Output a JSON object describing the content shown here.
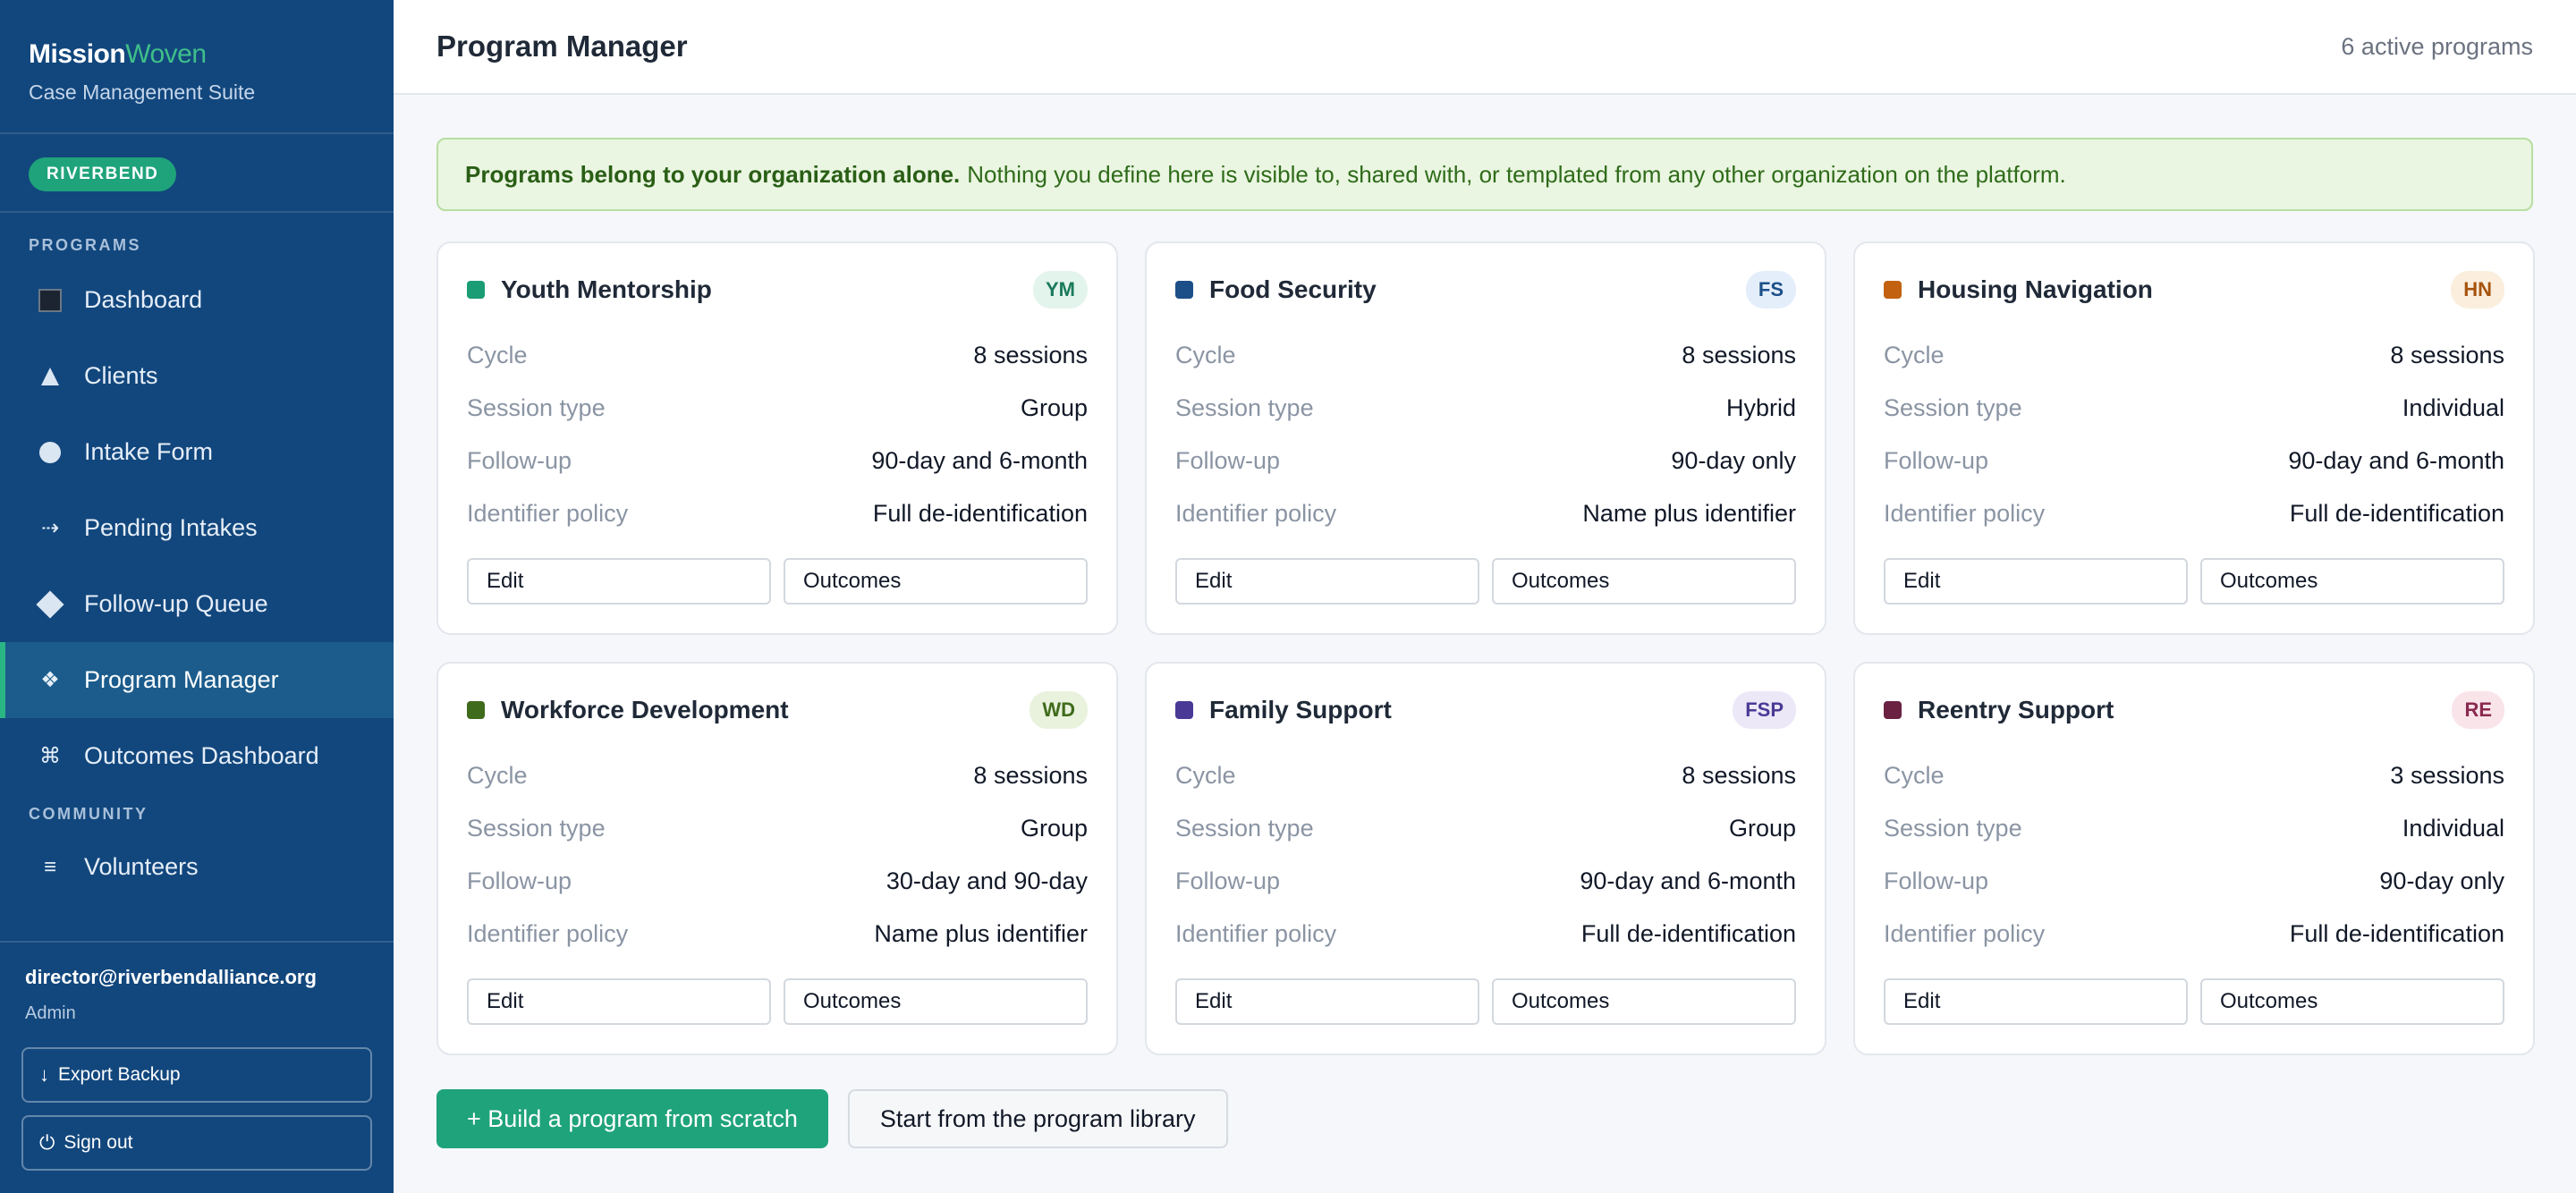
{
  "brand": {
    "name_part1": "Mission",
    "name_part2": "Woven",
    "subtitle": "Case Management Suite"
  },
  "org": {
    "badge": "RIVERBEND"
  },
  "sidebar": {
    "section_programs": "PROGRAMS",
    "section_community": "COMMUNITY",
    "items": [
      {
        "label": "Dashboard",
        "icon": "dashboard-icon"
      },
      {
        "label": "Clients",
        "icon": "clients-icon"
      },
      {
        "label": "Intake Form",
        "icon": "intake-form-icon"
      },
      {
        "label": "Pending Intakes",
        "icon": "pending-intakes-icon"
      },
      {
        "label": "Follow-up Queue",
        "icon": "follow-up-icon"
      },
      {
        "label": "Program Manager",
        "icon": "program-manager-icon",
        "active": true
      },
      {
        "label": "Outcomes Dashboard",
        "icon": "outcomes-icon"
      },
      {
        "label": "Volunteers",
        "icon": "volunteers-icon"
      }
    ],
    "user": {
      "email": "director@riverbendalliance.org",
      "role": "Admin"
    },
    "export_label": "Export Backup",
    "signout_label": "Sign out"
  },
  "header": {
    "title": "Program Manager",
    "active_count": "6 active programs"
  },
  "notice": {
    "strong": "Programs belong to your organization alone.",
    "text": "Nothing you define here is visible to, shared with, or templated from any other organization on the platform."
  },
  "labels": {
    "cycle": "Cycle",
    "session_type": "Session type",
    "follow_up": "Follow-up",
    "identifier_policy": "Identifier policy",
    "edit": "Edit",
    "outcomes": "Outcomes"
  },
  "programs": [
    {
      "name": "Youth Mentorship",
      "abbr": "YM",
      "color": "#1a9c74",
      "badge_bg": "#e3f4ec",
      "badge_fg": "#1a7a5b",
      "cycle": "8 sessions",
      "session_type": "Group",
      "follow_up": "90-day and 6-month",
      "identifier_policy": "Full de-identification"
    },
    {
      "name": "Food Security",
      "abbr": "FS",
      "color": "#1c4f88",
      "badge_bg": "#e4eefb",
      "badge_fg": "#1c4f88",
      "cycle": "8 sessions",
      "session_type": "Hybrid",
      "follow_up": "90-day only",
      "identifier_policy": "Name plus identifier"
    },
    {
      "name": "Housing Navigation",
      "abbr": "HN",
      "color": "#c2610f",
      "badge_bg": "#fbeedd",
      "badge_fg": "#a6530d",
      "cycle": "8 sessions",
      "session_type": "Individual",
      "follow_up": "90-day and 6-month",
      "identifier_policy": "Full de-identification"
    },
    {
      "name": "Workforce Development",
      "abbr": "WD",
      "color": "#3f6b1c",
      "badge_bg": "#e8f2dc",
      "badge_fg": "#3f6b1c",
      "cycle": "8 sessions",
      "session_type": "Group",
      "follow_up": "30-day and 90-day",
      "identifier_policy": "Name plus identifier"
    },
    {
      "name": "Family Support",
      "abbr": "FSP",
      "color": "#4a3a96",
      "badge_bg": "#ece8f8",
      "badge_fg": "#4a3a96",
      "cycle": "8 sessions",
      "session_type": "Group",
      "follow_up": "90-day and 6-month",
      "identifier_policy": "Full de-identification"
    },
    {
      "name": "Reentry Support",
      "abbr": "RE",
      "color": "#6b2242",
      "badge_bg": "#f9e4ea",
      "badge_fg": "#8a2a4f",
      "cycle": "3 sessions",
      "session_type": "Individual",
      "follow_up": "90-day only",
      "identifier_policy": "Full de-identification"
    }
  ],
  "actions": {
    "build": "+ Build a program from scratch",
    "library": "Start from the program library"
  },
  "colors": {
    "sidebar_bg": "#12477d",
    "accent": "#1fa37a",
    "notice_bg": "#eaf6e1"
  }
}
